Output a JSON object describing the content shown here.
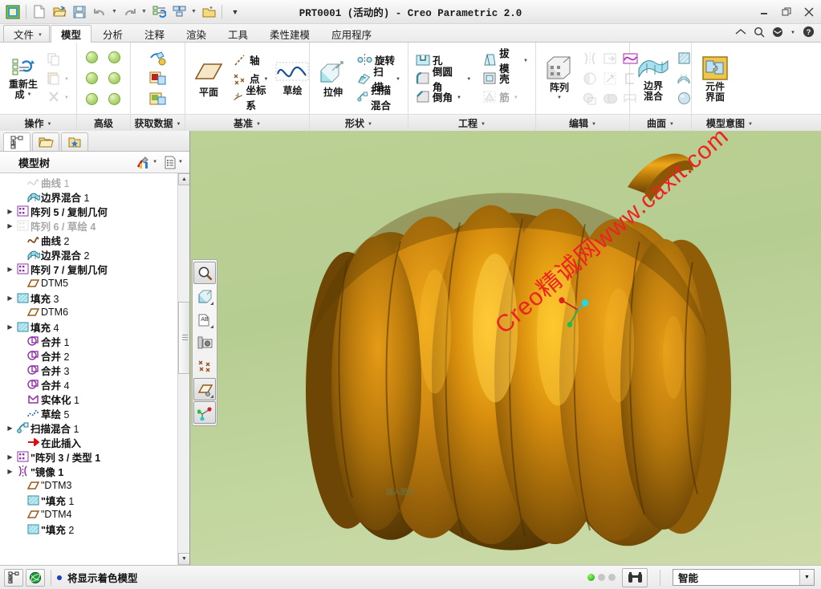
{
  "window": {
    "title": "PRT0001  (活动的) - Creo Parametric 2.0",
    "minimize": "─",
    "maximize": "❐",
    "close": "✕"
  },
  "quick_access": [
    {
      "name": "creo-logo-icon",
      "label": "Creo"
    },
    {
      "name": "new-file-icon",
      "label": "新建"
    },
    {
      "name": "open-file-icon",
      "label": "打开"
    },
    {
      "name": "save-icon",
      "label": "保存"
    },
    {
      "name": "undo-icon",
      "label": "撤消"
    },
    {
      "name": "redo-icon",
      "label": "重做"
    },
    {
      "name": "regenerate-icon",
      "label": "重新生成"
    },
    {
      "name": "window-switch-icon",
      "label": "窗口"
    },
    {
      "name": "close-window-icon",
      "label": "关闭"
    },
    {
      "name": "customize-qat-icon",
      "label": "自定义快速访问工具栏"
    }
  ],
  "tabs": [
    {
      "label": "文件",
      "active": false,
      "is_file": true
    },
    {
      "label": "模型",
      "active": true
    },
    {
      "label": "分析",
      "active": false
    },
    {
      "label": "注释",
      "active": false
    },
    {
      "label": "渲染",
      "active": false
    },
    {
      "label": "工具",
      "active": false
    },
    {
      "label": "柔性建模",
      "active": false
    },
    {
      "label": "应用程序",
      "active": false
    }
  ],
  "tab_right_icons": [
    {
      "name": "collapse-ribbon-icon"
    },
    {
      "name": "search-icon"
    },
    {
      "name": "saved-views-icon"
    },
    {
      "name": "help-icon"
    }
  ],
  "ribbon": {
    "groups": [
      {
        "name": "操作",
        "label": "操作",
        "has_dropdown": true,
        "big": {
          "label": "重新生\n成",
          "line1": "重新生",
          "line2": "成",
          "icon": "regenerate-icon",
          "dropdown": true
        },
        "small_icons": [
          {
            "name": "copy-icon",
            "disabled": true
          },
          {
            "name": "paste-icon",
            "disabled": true,
            "dropdown": true
          },
          {
            "name": "delete-icon",
            "disabled": true,
            "dropdown": true
          }
        ]
      },
      {
        "name": "高级",
        "label": "高级",
        "has_dropdown": false,
        "balls": 6
      },
      {
        "name": "获取数据",
        "label": "获取数据",
        "has_dropdown": true,
        "icons": [
          {
            "name": "user-defined-feature-icon"
          },
          {
            "name": "copy-geometry-icon"
          },
          {
            "name": "shrinkwrap-icon"
          }
        ]
      },
      {
        "name": "基准",
        "label": "基准",
        "has_dropdown": true,
        "plane_label": "平面",
        "items": [
          {
            "label": "轴",
            "icon": "datum-axis-icon"
          },
          {
            "label": "点",
            "icon": "datum-point-icon",
            "dropdown": true
          },
          {
            "label": "坐标系",
            "icon": "coordinate-system-icon"
          }
        ],
        "sketch_label": "草绘"
      },
      {
        "name": "形状",
        "label": "形状",
        "has_dropdown": true,
        "extrude_label": "拉伸",
        "items": [
          {
            "label": "旋转",
            "icon": "revolve-icon"
          },
          {
            "label": "扫描",
            "icon": "sweep-icon",
            "dropdown": true
          },
          {
            "label": "扫描混合",
            "icon": "swept-blend-icon"
          }
        ]
      },
      {
        "name": "工程",
        "label": "工程",
        "has_dropdown": true,
        "col1": [
          {
            "label": "孔",
            "icon": "hole-icon"
          },
          {
            "label": "倒圆角",
            "icon": "round-icon",
            "dropdown": true
          },
          {
            "label": "倒角",
            "icon": "chamfer-icon",
            "dropdown": true
          }
        ],
        "col2": [
          {
            "label": "拔模",
            "icon": "draft-icon",
            "dropdown": true
          },
          {
            "label": "壳",
            "icon": "shell-icon"
          },
          {
            "label": "筋",
            "icon": "rib-icon",
            "dropdown": true,
            "disabled": true
          }
        ]
      },
      {
        "name": "编辑",
        "label": "编辑",
        "has_dropdown": true,
        "pattern_label": "阵列",
        "grid_icons": [
          {
            "name": "mirror-icon",
            "disabled": true
          },
          {
            "name": "move-icon",
            "disabled": true
          },
          {
            "name": "curve-edit-icon",
            "disabled": false
          },
          {
            "name": "trim-icon",
            "disabled": true
          },
          {
            "name": "extend-icon",
            "disabled": true
          },
          {
            "name": "offset-icon",
            "disabled": true
          },
          {
            "name": "intersect-icon",
            "disabled": true
          },
          {
            "name": "merge-icon",
            "disabled": true
          },
          {
            "name": "thicken-icon",
            "disabled": true
          }
        ]
      },
      {
        "name": "曲面",
        "label": "曲面",
        "has_dropdown": true,
        "boundary_blend_line1": "边界",
        "boundary_blend_line2": "混合",
        "side_icons": [
          {
            "name": "fill-surface-icon"
          },
          {
            "name": "style-surface-icon"
          },
          {
            "name": "freestyle-icon"
          }
        ]
      },
      {
        "name": "模型意图",
        "label": "模型意图",
        "has_dropdown": true,
        "component_interface_line1": "元件",
        "component_interface_line2": "界面"
      }
    ]
  },
  "navigator": {
    "tabs": [
      {
        "name": "model-tree-tab",
        "icon": "tree-icon",
        "active": true
      },
      {
        "name": "folder-browser-tab",
        "icon": "folder-icon",
        "active": false
      },
      {
        "name": "favorites-tab",
        "icon": "favorites-folder-icon",
        "active": false
      }
    ],
    "header": {
      "title": "模型树",
      "settings_icon": "tree-filters-icon",
      "display_icon": "tree-display-icon"
    },
    "tree_items": [
      {
        "label": "曲线",
        "num": "1",
        "icon": "curve-icon",
        "expand": false,
        "dim": true,
        "indent": 1
      },
      {
        "label": "边界混合",
        "num": "1",
        "icon": "boundary-blend-icon",
        "expand": false,
        "dim": false,
        "indent": 1
      },
      {
        "label": "阵列 5 / 复制几何",
        "num": "",
        "icon": "pattern-icon",
        "expand": true,
        "dim": false,
        "indent": 0
      },
      {
        "label": "阵列 6 / 草绘 4",
        "num": "",
        "icon": "pattern-icon",
        "expand": true,
        "dim": true,
        "indent": 0
      },
      {
        "label": "曲线",
        "num": "2",
        "icon": "curve-icon",
        "expand": false,
        "dim": false,
        "indent": 1
      },
      {
        "label": "边界混合",
        "num": "2",
        "icon": "boundary-blend-icon",
        "expand": false,
        "dim": false,
        "indent": 1
      },
      {
        "label": "阵列 7 / 复制几何",
        "num": "",
        "icon": "pattern-icon",
        "expand": true,
        "dim": false,
        "indent": 0
      },
      {
        "label": "DTM5",
        "num": "",
        "icon": "datum-plane-icon",
        "expand": false,
        "dim": false,
        "indent": 1,
        "plain": true
      },
      {
        "label": "填充",
        "num": "3",
        "icon": "fill-icon",
        "expand": true,
        "dim": false,
        "indent": 0
      },
      {
        "label": "DTM6",
        "num": "",
        "icon": "datum-plane-icon",
        "expand": false,
        "dim": false,
        "indent": 1,
        "plain": true
      },
      {
        "label": "填充",
        "num": "4",
        "icon": "fill-icon",
        "expand": true,
        "dim": false,
        "indent": 0
      },
      {
        "label": "合并",
        "num": "1",
        "icon": "merge-feature-icon",
        "expand": false,
        "dim": false,
        "indent": 1
      },
      {
        "label": "合并",
        "num": "2",
        "icon": "merge-feature-icon",
        "expand": false,
        "dim": false,
        "indent": 1
      },
      {
        "label": "合并",
        "num": "3",
        "icon": "merge-feature-icon",
        "expand": false,
        "dim": false,
        "indent": 1
      },
      {
        "label": "合并",
        "num": "4",
        "icon": "merge-feature-icon",
        "expand": false,
        "dim": false,
        "indent": 1
      },
      {
        "label": "实体化",
        "num": "1",
        "icon": "solidify-icon",
        "expand": false,
        "dim": false,
        "indent": 1
      },
      {
        "label": "草绘",
        "num": "5",
        "icon": "sketch-icon",
        "expand": false,
        "dim": false,
        "indent": 1
      },
      {
        "label": "扫描混合",
        "num": "1",
        "icon": "swept-blend-tree-icon",
        "expand": true,
        "dim": false,
        "indent": 0
      },
      {
        "label": "在此插入",
        "num": "",
        "icon": "insert-here-icon",
        "expand": false,
        "dim": false,
        "indent": 1
      },
      {
        "label": "\"阵列 3 / 类型 1",
        "num": "",
        "icon": "pattern-icon",
        "expand": true,
        "dim": false,
        "indent": 0
      },
      {
        "label": "\"镜像 1",
        "num": "",
        "icon": "mirror-tree-icon",
        "expand": true,
        "dim": false,
        "indent": 0
      },
      {
        "label": "\"DTM3",
        "num": "",
        "icon": "datum-plane-icon",
        "expand": false,
        "dim": false,
        "indent": 1,
        "plain": true
      },
      {
        "label": "\"填充",
        "num": "1",
        "icon": "fill-icon",
        "expand": false,
        "dim": false,
        "indent": 1
      },
      {
        "label": "\"DTM4",
        "num": "",
        "icon": "datum-plane-icon",
        "expand": false,
        "dim": false,
        "indent": 1,
        "plain": true
      },
      {
        "label": "\"填充",
        "num": "2",
        "icon": "fill-icon",
        "expand": false,
        "dim": false,
        "indent": 1
      }
    ]
  },
  "viewport": {
    "watermark": "Creo精诚网www.caxit.com",
    "hint_text": "插入图元",
    "background_color": "#bcd194",
    "model_color": "#c98a12",
    "graphics_toolbar": [
      {
        "name": "zoom-in-icon",
        "selected": true,
        "corner": false
      },
      {
        "name": "display-style-icon",
        "selected": false,
        "corner": true
      },
      {
        "name": "annotation-display-icon",
        "selected": false,
        "corner": true
      },
      {
        "name": "saved-view-icon",
        "selected": false,
        "corner": false
      },
      {
        "name": "datum-display-icon",
        "selected": false,
        "corner": false
      },
      {
        "name": "plane-display-icon",
        "selected": true,
        "corner": true
      },
      {
        "name": "csys-display-icon",
        "selected": true,
        "corner": false
      }
    ]
  },
  "status_bar": {
    "left_icons": [
      {
        "name": "model-tree-toggle-icon"
      },
      {
        "name": "browser-toggle-icon"
      }
    ],
    "message": "将显示着色模型",
    "lights": [
      true,
      false,
      false
    ],
    "search_icon": "binoculars-icon",
    "selection_filter": "智能"
  }
}
